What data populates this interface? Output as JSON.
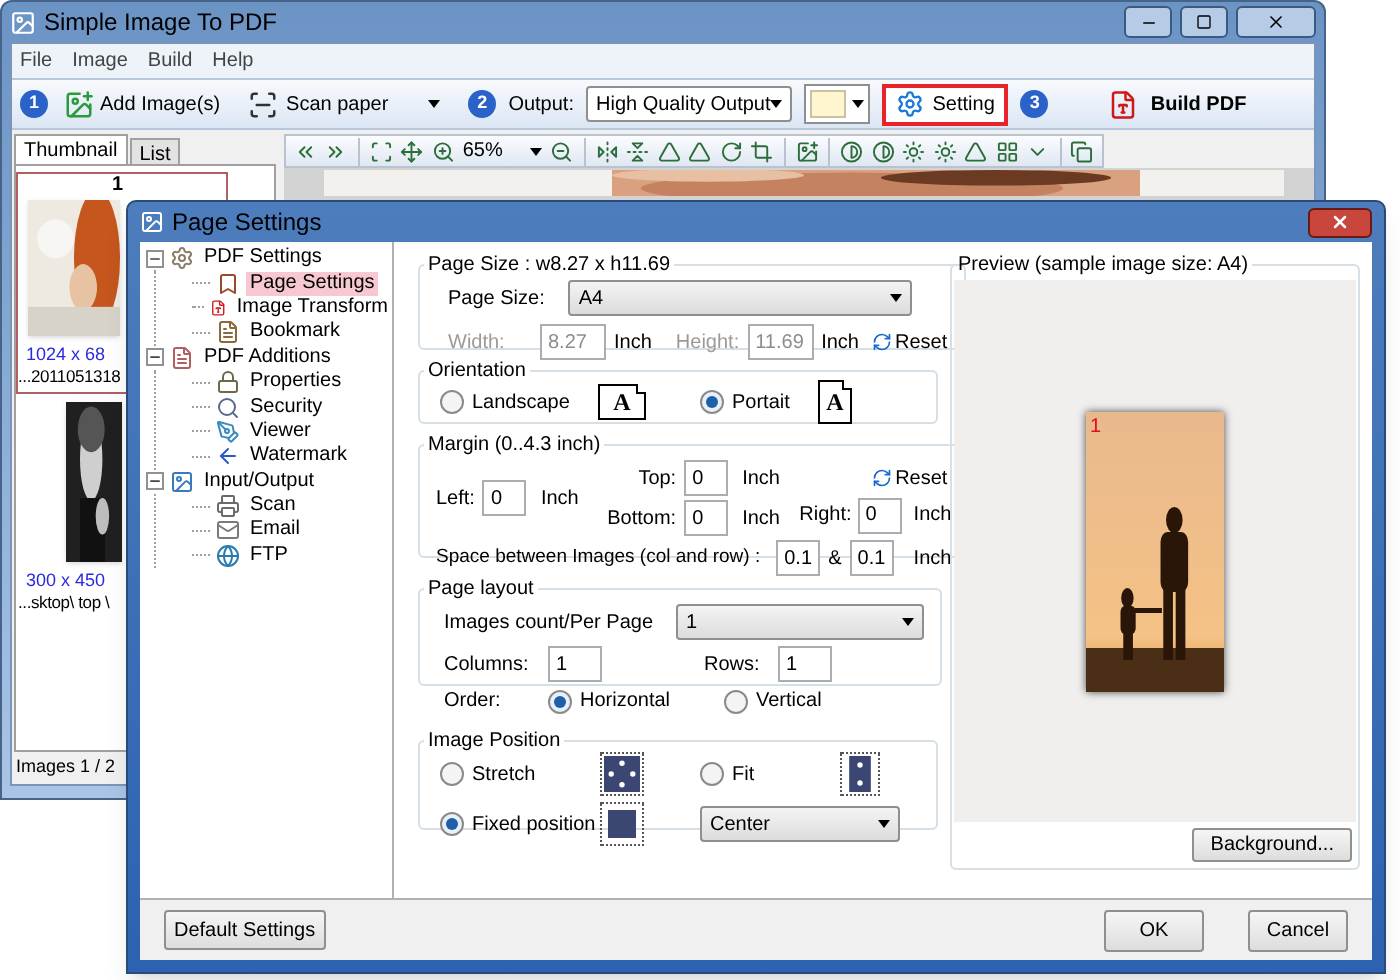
{
  "main_window": {
    "title": "Simple Image To PDF",
    "menu": [
      "File",
      "Image",
      "Build",
      "Help"
    ]
  },
  "toolbar": {
    "step1": "1",
    "add_images": "Add Image(s)",
    "scan_paper": "Scan paper",
    "step2": "2",
    "output_label": "Output:",
    "output_value": "High Quality Output",
    "setting": "Setting",
    "setting_highlighted": true,
    "step3": "3",
    "build_pdf": "Build PDF"
  },
  "side_tabs": [
    {
      "label": "Thumbnail",
      "selected": true
    },
    {
      "label": "List",
      "selected": false
    }
  ],
  "thumbnails": [
    {
      "number": "1",
      "size": "1024 x 68",
      "path": "...2011051318",
      "selected": true
    },
    {
      "size": "300 x 450",
      "path": "...sktop\\ top \\",
      "selected": false
    }
  ],
  "image_toolbar": {
    "zoom": "65%"
  },
  "status_bar": "Images 1 / 2",
  "dialog": {
    "title": "Page Settings",
    "tree": [
      {
        "label": "PDF Settings",
        "expanded": true,
        "selected": false,
        "children": [
          {
            "label": "Page Settings",
            "selected": true
          },
          {
            "label": "Image Transform",
            "selected": false
          },
          {
            "label": "Bookmark",
            "selected": false
          }
        ]
      },
      {
        "label": "PDF Additions",
        "expanded": true,
        "selected": false,
        "children": [
          {
            "label": "Properties",
            "selected": false
          },
          {
            "label": "Security",
            "selected": false
          },
          {
            "label": "Viewer",
            "selected": false
          },
          {
            "label": "Watermark",
            "selected": false
          }
        ]
      },
      {
        "label": "Input/Output",
        "expanded": true,
        "selected": false,
        "children": [
          {
            "label": "Scan",
            "selected": false
          },
          {
            "label": "Email",
            "selected": false
          },
          {
            "label": "FTP",
            "selected": false
          }
        ]
      }
    ],
    "page_size": {
      "title": "Page Size : w8.27 x h11.69",
      "size_label": "Page Size:",
      "size_value": "A4",
      "dimensions_disabled": true,
      "width_label": "Width:",
      "width_value": "8.27",
      "width_unit": "Inch",
      "height_label": "Height:",
      "height_value": "11.69",
      "height_unit": "Inch",
      "reset": "Reset"
    },
    "orientation": {
      "title": "Orientation",
      "options": [
        {
          "label": "Landscape",
          "selected": false,
          "page_letter": "A",
          "kind": "landscape"
        },
        {
          "label": "Portait",
          "selected": true,
          "page_letter": "A",
          "kind": "portrait"
        }
      ]
    },
    "margin": {
      "title": "Margin (0..4.3 inch)",
      "top_label": "Top:",
      "top_value": "0",
      "top_unit": "Inch",
      "reset": "Reset",
      "left_label": "Left:",
      "left_value": "0",
      "left_unit": "Inch",
      "right_label": "Right:",
      "right_value": "0",
      "right_unit": "Inch",
      "bottom_label": "Bottom:",
      "bottom_value": "0",
      "bottom_unit": "Inch",
      "spacing_label": "Space between Images (col and row) :",
      "spacing_col": "0.1",
      "spacing_sep": "&",
      "spacing_row": "0.1",
      "spacing_unit": "Inch"
    },
    "page_layout": {
      "title": "Page layout",
      "count_label": "Images count/Per Page",
      "count_value": "1",
      "columns_label": "Columns:",
      "columns_value": "1",
      "rows_label": "Rows:",
      "rows_value": "1",
      "order_label": "Order:",
      "order_options": [
        {
          "label": "Horizontal",
          "selected": true
        },
        {
          "label": "Vertical",
          "selected": false
        }
      ]
    },
    "image_position": {
      "title": "Image Position",
      "options": [
        {
          "label": "Stretch",
          "selected": false,
          "kind": "stretch"
        },
        {
          "label": "Fit",
          "selected": false,
          "kind": "fit"
        },
        {
          "label": "Fixed position",
          "selected": true,
          "kind": "fixed"
        }
      ],
      "anchor": "Center"
    },
    "preview": {
      "title": "Preview (sample image size: A4)",
      "page_number": "1",
      "background_button": "Background..."
    },
    "buttons": {
      "default": "Default Settings",
      "ok": "OK",
      "cancel": "Cancel"
    }
  }
}
